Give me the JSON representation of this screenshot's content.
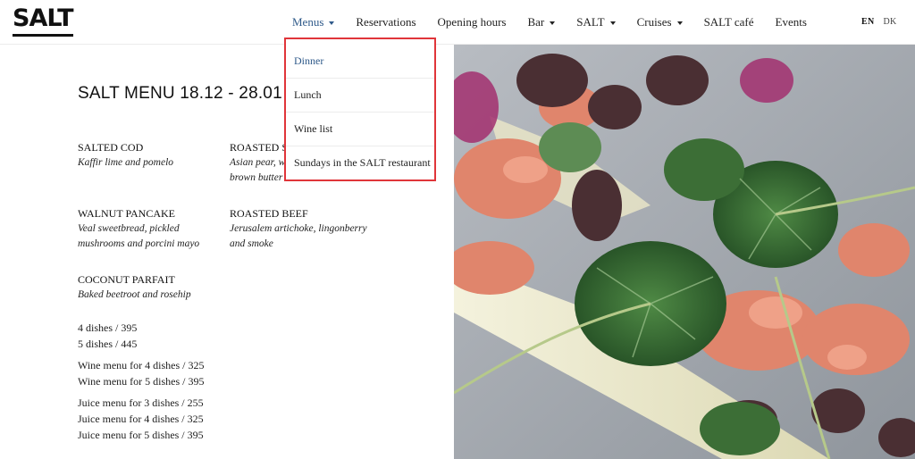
{
  "header": {
    "logo": "SALT",
    "nav": [
      {
        "label": "Menus",
        "has_dropdown": true,
        "active": true
      },
      {
        "label": "Reservations",
        "has_dropdown": false
      },
      {
        "label": "Opening hours",
        "has_dropdown": false
      },
      {
        "label": "Bar",
        "has_dropdown": true
      },
      {
        "label": "SALT",
        "has_dropdown": true
      },
      {
        "label": "Cruises",
        "has_dropdown": true
      },
      {
        "label": "SALT café",
        "has_dropdown": false
      },
      {
        "label": "Events",
        "has_dropdown": false
      }
    ],
    "languages": {
      "active": "EN",
      "other": "DK"
    }
  },
  "dropdown": {
    "items": [
      {
        "label": "Dinner",
        "selected": true
      },
      {
        "label": "Lunch"
      },
      {
        "label": "Wine list"
      },
      {
        "label": "Sundays in the SALT restaurant"
      }
    ],
    "highlight_color": "#e0353a"
  },
  "menu": {
    "title": "SALT MENU 18.12 - 28.01",
    "dishes": [
      {
        "name": "SALTED COD",
        "desc": "Kaffir lime and pomelo"
      },
      {
        "name": "ROASTED SCALLOP",
        "desc": "Asian pear, with beurre blanc and brown butter"
      },
      {
        "name": "WALNUT PANCAKE",
        "desc": "Veal sweetbread, pickled mushrooms and porcini mayo"
      },
      {
        "name": "ROASTED BEEF",
        "desc": "Jerusalem artichoke, lingonberry and smoke"
      },
      {
        "name": "COCONUT PARFAIT",
        "desc": "Baked beetroot and rosehip"
      }
    ],
    "prices": {
      "dishes": [
        "4 dishes / 395",
        "5 dishes / 445"
      ],
      "wine": [
        "Wine menu for 4 dishes / 325",
        "Wine menu for 5 dishes / 395"
      ],
      "juice": [
        "Juice menu for 3 dishes / 255",
        "Juice menu for 4 dishes / 325",
        "Juice menu for 5 dishes / 395"
      ]
    }
  },
  "image": {
    "subject": "plated dish with salmon tartare, nasturtium leaves and white asparagus"
  },
  "colors": {
    "link_blue": "#2f5a8a",
    "text": "#222222"
  }
}
